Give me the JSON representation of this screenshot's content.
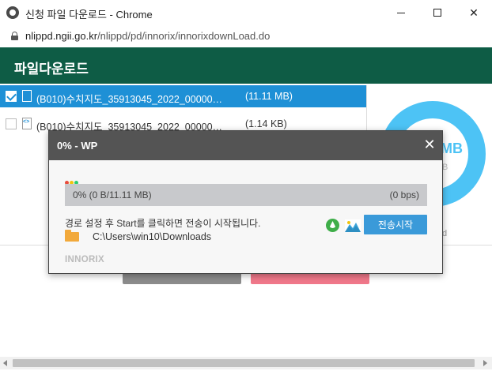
{
  "window": {
    "title": "신청 파일 다운로드 - Chrome",
    "close_glyph": "✕"
  },
  "address": {
    "host": "nlippd.ngii.go.kr",
    "path": "/nlippd/pd/innorix/innorixdownLoad.do"
  },
  "header": {
    "title": "파일다운로드"
  },
  "files": [
    {
      "name": "(B010)수치지도_35913045_2022_00000…",
      "size": "(11.11 MB)",
      "checked": true
    },
    {
      "name": "(B010)수치지도_35913045_2022_00000…",
      "size": "(1.14 KB)",
      "checked": false
    }
  ],
  "donut": {
    "value_partial": "MB",
    "sub_partial": "B",
    "sub2_partial": "d"
  },
  "background_buttons": {
    "left_label": "",
    "right_label": ""
  },
  "dialog": {
    "title": "0% - WP",
    "close_glyph": "✕",
    "progress_text": "0% (0 B/11.11 MB)",
    "progress_value": 0,
    "speed": "(0 bps)",
    "message": "경로 설정 후 Start를 클릭하면 전송이 시작됩니다.",
    "path": "C:\\Users\\win10\\Downloads",
    "start_button": "전송시작",
    "brand": "INNORIX"
  },
  "colors": {
    "header_green": "#0e5c45",
    "selected_blue": "#1e90d6",
    "donut_blue": "#4dc3f5",
    "dialog_header": "#545454",
    "button_blue": "#3a9ad9",
    "dot_red": "#e74c3c",
    "dot_yellow": "#f1c40f",
    "dot_green": "#2ecc71"
  }
}
